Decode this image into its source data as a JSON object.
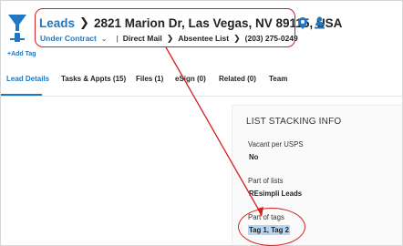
{
  "header": {
    "leads_link": "Leads",
    "address": "2821 Marion Dr, Las Vegas, NV 89115, USA",
    "status": "Under Contract",
    "source": "Direct Mail",
    "list": "Absentee List",
    "phone": "(203) 275-0249",
    "add_tag": "+Add Tag"
  },
  "tabs": [
    {
      "label": "Lead Details",
      "active": true
    },
    {
      "label": "Tasks & Appts (15)"
    },
    {
      "label": "Files (1)"
    },
    {
      "label": "eSign (0)"
    },
    {
      "label": "Related (0)"
    },
    {
      "label": "Team"
    }
  ],
  "list_stacking": {
    "title": "LIST STACKING INFO",
    "vacant_label": "Vacant per USPS",
    "vacant_value": "No",
    "lists_label": "Part of lists",
    "lists_value": "REsimpli Leads",
    "tags_label": "Part of tags",
    "tags_value": "Tag 1,  Tag 2"
  },
  "colors": {
    "accent_blue": "#1f78c1",
    "annotation_red": "#d42020",
    "selection_highlight": "#b9d4ef"
  },
  "icons": [
    "funnel-icon",
    "map-pin-icon",
    "user-pin-icon",
    "chevron-right-icon",
    "chevron-down-icon"
  ]
}
